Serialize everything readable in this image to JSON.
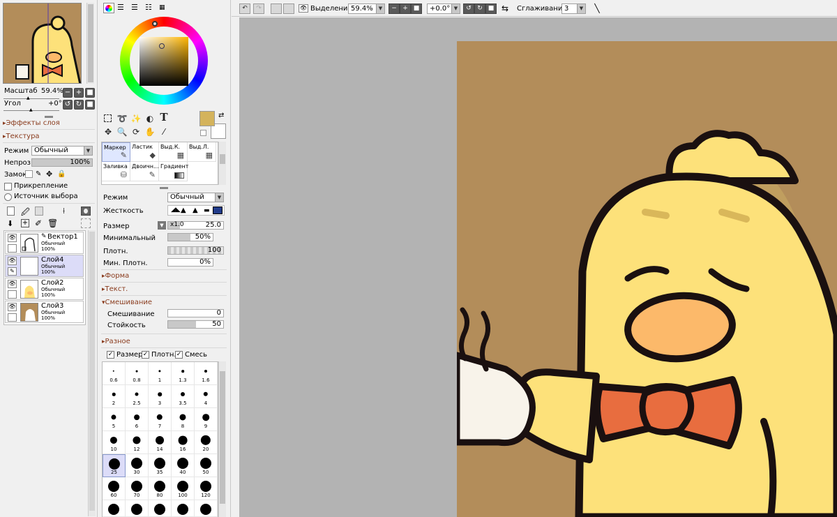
{
  "navigator": {
    "zoom_label": "Масштаб",
    "zoom_value": "59.4%",
    "angle_label": "Угол",
    "angle_value": "+0°"
  },
  "layer_panel": {
    "sections": [
      "Эффекты слоя",
      "Текстура"
    ],
    "mode_label": "Режим",
    "mode_value": "Обычный",
    "opacity_label": "Непроз.",
    "opacity_value": "100%",
    "opacity_percent": 100,
    "lock_label": "Замок",
    "clipping_label": "Прикрепление",
    "selection_source_label": "Источник выбора",
    "layers": [
      {
        "name": "Вектор1",
        "mode": "Обычный",
        "opacity": "100%",
        "vector": true,
        "selected": false
      },
      {
        "name": "Слой4",
        "mode": "Обычный",
        "opacity": "100%",
        "vector": false,
        "selected": true
      },
      {
        "name": "Слой2",
        "mode": "Обычный",
        "opacity": "100%",
        "vector": false,
        "selected": false
      },
      {
        "name": "Слой3",
        "mode": "Обычный",
        "opacity": "100%",
        "vector": false,
        "selected": false
      }
    ]
  },
  "tools": {
    "brushes": [
      {
        "label": "Маркер",
        "icon": "pen-icon",
        "selected": true
      },
      {
        "label": "Ластик",
        "icon": "eraser-icon",
        "selected": false
      },
      {
        "label": "Выд.К.",
        "icon": "select-pen-icon",
        "selected": false
      },
      {
        "label": "Выд.Л.",
        "icon": "deselect-pen-icon",
        "selected": false
      },
      {
        "label": "Заливка",
        "icon": "bucket-icon",
        "selected": false
      },
      {
        "label": "Двоичн...",
        "icon": "binary-pen-icon",
        "selected": false
      },
      {
        "label": "Градиент",
        "icon": "gradient-icon",
        "selected": false
      }
    ],
    "primary_color": "#d4b35c",
    "secondary_color": "#ffffff"
  },
  "brush_settings": {
    "mode_label": "Режим",
    "mode_value": "Обычный",
    "hardness_label": "Жесткость",
    "size_label": "Размер",
    "size_multiplier": "x1.0",
    "size_value": "25.0",
    "min_size_label": "Минимальный",
    "min_size_value": "50%",
    "min_size_percent": 50,
    "density_label": "Плотн.",
    "density_value": "100",
    "density_percent": 100,
    "min_density_label": "Мин. Плотн.",
    "min_density_value": "0%",
    "min_density_percent": 0,
    "shape_label": "Форма",
    "texture_label": "Текст.",
    "blending_section": "Смешивание",
    "blending_label": "Смешивание",
    "blending_value": "0",
    "blending_percent": 0,
    "persistence_label": "Стойкость",
    "persistence_value": "50",
    "persistence_percent": 50,
    "misc_section": "Разное",
    "check_size": "Размер",
    "check_density": "Плотн.",
    "check_blend": "Смесь"
  },
  "brush_sizes": [
    [
      "0.6",
      "0.8",
      "1",
      "1.3",
      "1.6"
    ],
    [
      "2",
      "2.5",
      "3",
      "3.5",
      "4"
    ],
    [
      "5",
      "6",
      "7",
      "8",
      "9"
    ],
    [
      "10",
      "12",
      "14",
      "16",
      "20"
    ],
    [
      "25",
      "30",
      "35",
      "40",
      "50"
    ],
    [
      "60",
      "70",
      "80",
      "100",
      "120"
    ]
  ],
  "selected_size": "25",
  "toolbar": {
    "selection_label": "Выделение",
    "zoom_value": "59.4%",
    "angle_value": "+0.0°",
    "stabilizer_label": "Сглаживание",
    "stabilizer_value": "3"
  },
  "colors": {
    "canvas_bg": "#b3b3b3",
    "artwork_bg": "#b38d5a",
    "chick_yellow": "#fde17a",
    "beak_orange": "#fcb96a",
    "bowtie_orange": "#e86d3f",
    "section_accent": "#8a3c1e"
  }
}
